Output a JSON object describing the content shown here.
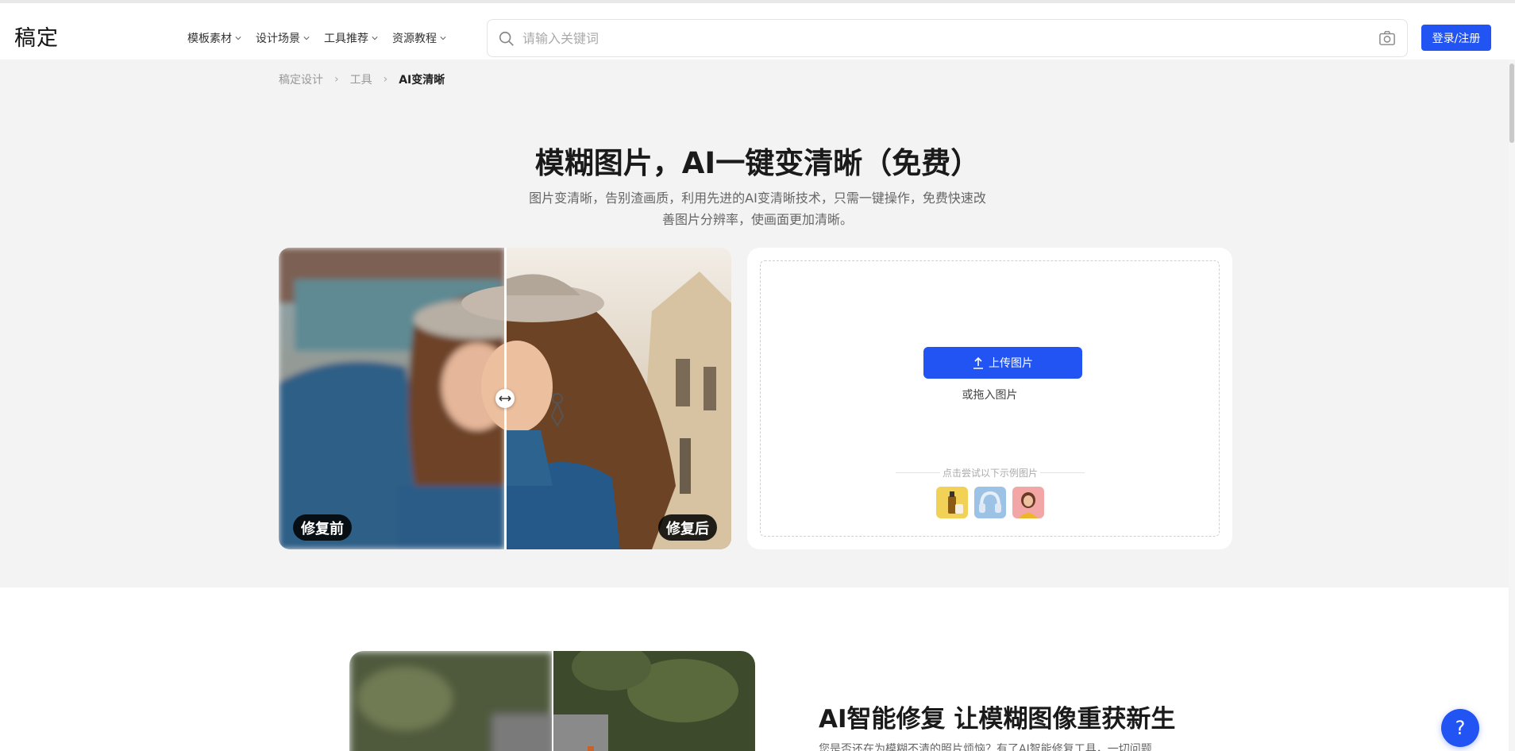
{
  "header": {
    "logo": "稿定",
    "nav": [
      {
        "label": "模板素材"
      },
      {
        "label": "设计场景"
      },
      {
        "label": "工具推荐"
      },
      {
        "label": "资源教程"
      }
    ],
    "search_placeholder": "请输入关键词",
    "login_label": "登录/注册",
    "accent_color": "#2254f4"
  },
  "breadcrumb": [
    "稿定设计",
    "工具",
    "AI变清晰"
  ],
  "hero": {
    "title": "模糊图片，AI一键变清晰（免费）",
    "subtitle": "图片变清晰，告别渣画质，利用先进的AI变清晰技术，只需一键操作，免费快速改善图片分辨率，使画面更加清晰。",
    "before_label": "修复前",
    "after_label": "修复后"
  },
  "upload": {
    "button_label": "上传图片",
    "drag_hint": "或拖入图片",
    "sample_hint": "点击尝试以下示例图片",
    "samples": [
      "sample-bottle",
      "sample-headphones",
      "sample-portrait"
    ]
  },
  "section": {
    "title": "AI智能修复 让模糊图像重获新生",
    "desc": "您是否还在为模糊不清的照片烦恼？有了AI智能修复工具，一切问题"
  },
  "help_label": "?"
}
